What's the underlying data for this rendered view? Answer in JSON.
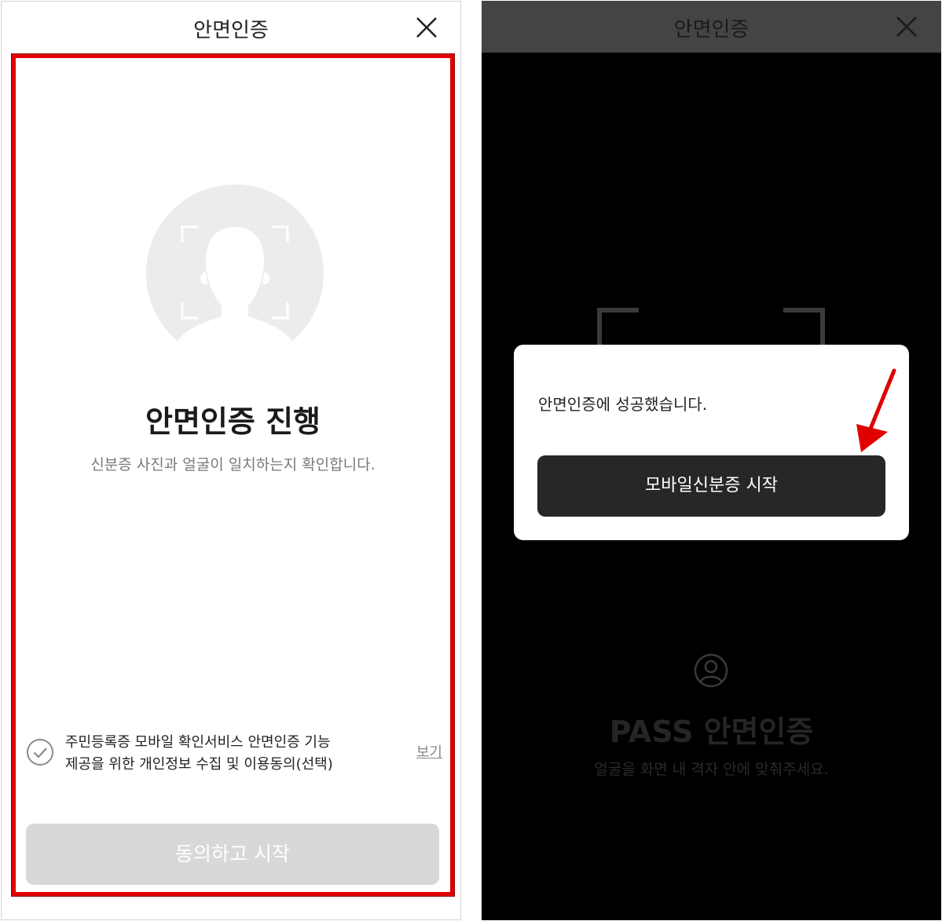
{
  "left_screen": {
    "header": {
      "title": "안면인증",
      "close_icon": "close-icon"
    },
    "face_icon": "face-scan-icon",
    "main_title": "안면인증 진행",
    "subtitle": "신분증 사진과 얼굴이 일치하는지 확인합니다.",
    "consent": {
      "line1": "주민등록증 모바일 확인서비스 안면인증 기능",
      "line2": "제공을 위한 개인정보 수집 및 이용동의(선택)",
      "view_label": "보기",
      "checked": false
    },
    "start_button": "동의하고 시작",
    "highlight_color": "#e00000"
  },
  "right_screen": {
    "header": {
      "title": "안면인증",
      "close_icon": "close-icon"
    },
    "dialog": {
      "message": "안면인증에 성공했습니다.",
      "button": "모바일신분증 시작"
    },
    "pass_title": "PASS 안면인증",
    "pass_subtitle": "얼굴을 화면 내 격자 안에 맞춰주세요.",
    "arrow_color": "#e00000"
  }
}
